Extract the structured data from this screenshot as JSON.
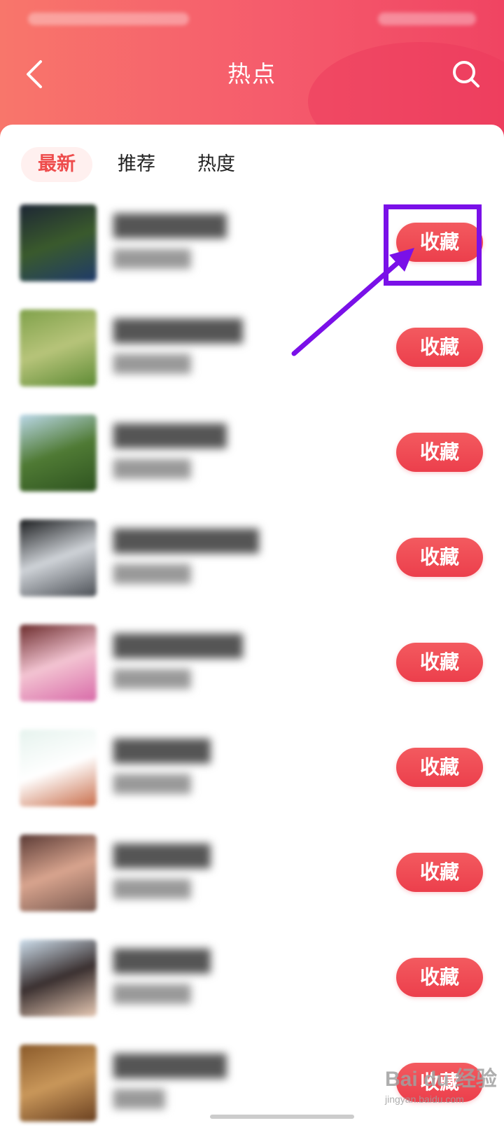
{
  "header": {
    "title": "热点",
    "back_icon": "chevron-left-icon",
    "search_icon": "search-icon",
    "gradient_colors": [
      "#f8766b",
      "#f04462"
    ]
  },
  "tabs": [
    {
      "label": "最新",
      "active": true
    },
    {
      "label": "推荐",
      "active": false
    },
    {
      "label": "热度",
      "active": false
    }
  ],
  "list": {
    "items": [
      {
        "title": "███████",
        "count": "██████",
        "button": "收藏",
        "thumb_colors": [
          "#1d2635",
          "#3a5a2c",
          "#1f3a6a"
        ]
      },
      {
        "title": "████████",
        "count": "██████",
        "button": "收藏",
        "thumb_colors": [
          "#7fa14a",
          "#b7c47a",
          "#5d8a34"
        ]
      },
      {
        "title": "███████",
        "count": "██████",
        "button": "收藏",
        "thumb_colors": [
          "#bcd9ea",
          "#4f7a34",
          "#2e5320"
        ]
      },
      {
        "title": "█████████",
        "count": "██████",
        "button": "收藏",
        "thumb_colors": [
          "#1a1c1e",
          "#cfd3d8",
          "#4b4f55"
        ]
      },
      {
        "title": "████████",
        "count": "██████",
        "button": "收藏",
        "thumb_colors": [
          "#6b2b2b",
          "#f3c4d2",
          "#d86aa8"
        ]
      },
      {
        "title": "██████",
        "count": "██████",
        "button": "收藏",
        "thumb_colors": [
          "#e6f3ee",
          "#ffffff",
          "#c86d4a"
        ]
      },
      {
        "title": "██████",
        "count": "██████",
        "button": "收藏",
        "thumb_colors": [
          "#5a3a35",
          "#d8a48e",
          "#7a5a50"
        ]
      },
      {
        "title": "██████",
        "count": "██████",
        "button": "收藏",
        "thumb_colors": [
          "#cfe0ee",
          "#3a3030",
          "#e7c9b4"
        ]
      },
      {
        "title": "███████",
        "count": "████",
        "button": "收藏",
        "thumb_colors": [
          "#8a5a2a",
          "#c9975a",
          "#6a4020"
        ]
      }
    ]
  },
  "watermark": {
    "main": "Bai du 经验",
    "sub": "jingyan.baidu.com"
  },
  "colors": {
    "accent": "#ee4c4c",
    "button": "#ec3f4c",
    "annotation": "#7a10e8"
  }
}
